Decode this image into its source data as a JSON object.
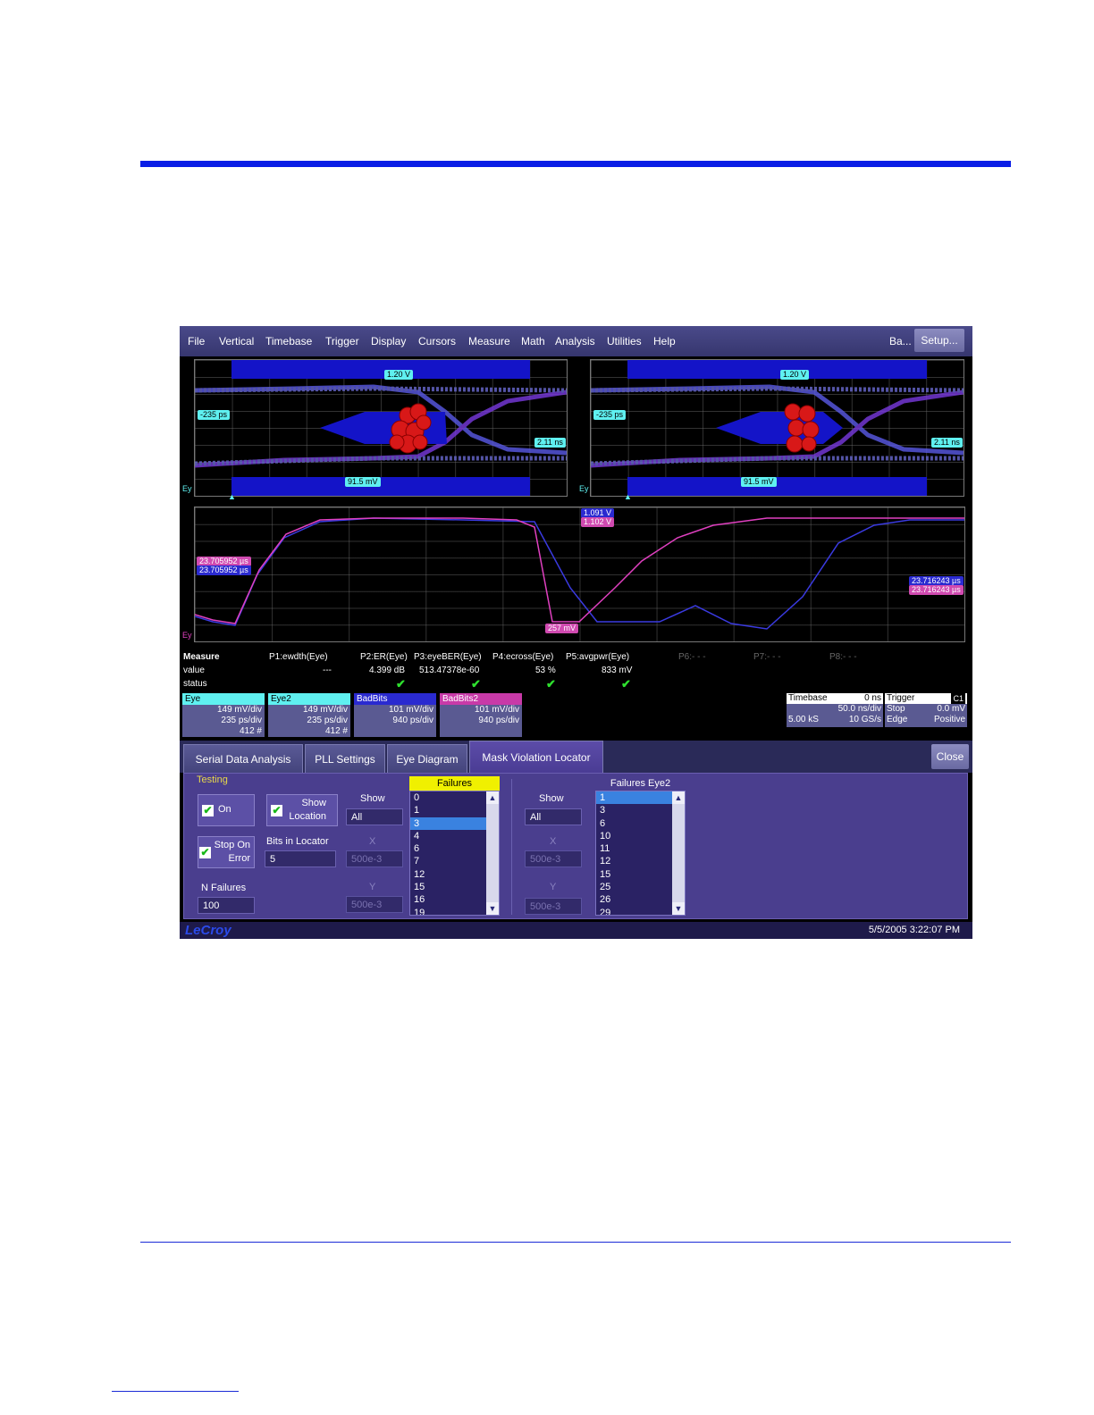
{
  "menubar": {
    "items": [
      "File",
      "Vertical",
      "Timebase",
      "Trigger",
      "Display",
      "Cursors",
      "Measure",
      "Math",
      "Analysis",
      "Utilities",
      "Help"
    ],
    "ba_label": "Ba...",
    "setup_label": "Setup..."
  },
  "eye1": {
    "top_label": "1.20 V",
    "left_label": "-235 ps",
    "right_label": "2.11 ns",
    "bottom_label": "91.5 mV",
    "trace_label": "Ey"
  },
  "eye2": {
    "top_label": "1.20 V",
    "left_label": "-235 ps",
    "right_label": "2.11 ns",
    "bottom_label": "91.5 mV",
    "trace_label": "Ey"
  },
  "wave": {
    "left_tag_mag": "23.705952 µs",
    "left_tag_blue": "23.705952 µs",
    "top_tag_blue": "1.091 V",
    "top_tag_mag": "1.102 V",
    "mid_tag": "257 mV",
    "right_tag_blue": "23.716243 µs",
    "right_tag_mag": "23.716243 µs",
    "trace_label": "Ey"
  },
  "measure": {
    "row_labels": [
      "Measure",
      "value",
      "status"
    ],
    "params": [
      {
        "name": "P1:ewdth(Eye)",
        "value": "---",
        "ok": false
      },
      {
        "name": "P2:ER(Eye)",
        "value": "4.399 dB",
        "ok": true
      },
      {
        "name": "P3:eyeBER(Eye)",
        "value": "513.47378e-60",
        "ok": true
      },
      {
        "name": "P4:ecross(Eye)",
        "value": "53 %",
        "ok": true
      },
      {
        "name": "P5:avgpwr(Eye)",
        "value": "833 mV",
        "ok": true
      }
    ],
    "empty_params": [
      "P6:- - -",
      "P7:- - -",
      "P8:- - -"
    ],
    "check_glyph": "✔"
  },
  "channels": [
    {
      "name": "Eye",
      "vdiv": "149 mV/div",
      "tdiv": "235 ps/div",
      "count": "412 #",
      "color": "#5ff0f0",
      "text": "#000000"
    },
    {
      "name": "Eye2",
      "vdiv": "149 mV/div",
      "tdiv": "235 ps/div",
      "count": "412 #",
      "color": "#5ff0f0",
      "text": "#000000"
    },
    {
      "name": "BadBits",
      "vdiv": "101 mV/div",
      "tdiv": "940 ps/div",
      "count": "",
      "color": "#2a2ad0",
      "text": "#ffffff"
    },
    {
      "name": "BadBits2",
      "vdiv": "101 mV/div",
      "tdiv": "940 ps/div",
      "count": "",
      "color": "#c83aa8",
      "text": "#ffffff"
    }
  ],
  "timebase": {
    "title": "Timebase",
    "offset": "0 ns",
    "tdiv": "50.0 ns/div",
    "samples": "5.00 kS",
    "rate": "10 GS/s"
  },
  "trigger": {
    "title": "Trigger",
    "channel": "C1",
    "mode": "Stop",
    "level": "0.0 mV",
    "type": "Edge",
    "slope": "Positive"
  },
  "tabs": [
    "Serial Data Analysis",
    "PLL Settings",
    "Eye Diagram",
    "Mask Violation Locator"
  ],
  "close_label": "Close",
  "dialog": {
    "testing_label": "Testing",
    "on_label": "On",
    "show_location_label_1": "Show",
    "show_location_label_2": "Location",
    "stop_on_error_label_1": "Stop On",
    "stop_on_error_label_2": "Error",
    "n_failures_label": "N Failures",
    "n_failures_value": "100",
    "bits_in_locator_label": "Bits in Locator",
    "bits_in_locator_value": "5",
    "show_label": "Show",
    "show_value": "All",
    "x_label": "X",
    "x_value": "500e-3",
    "y_label": "Y",
    "y_value": "500e-3",
    "failures_label": "Failures",
    "failures": [
      "0",
      "1",
      "3",
      "4",
      "6",
      "7",
      "12",
      "15",
      "16",
      "19"
    ],
    "failures_selected": 2,
    "show2_label": "Show",
    "show2_value": "All",
    "x2_label": "X",
    "x2_value": "500e-3",
    "y2_label": "Y",
    "y2_value": "500e-3",
    "failures2_label": "Failures Eye2",
    "failures2": [
      "1",
      "3",
      "6",
      "10",
      "11",
      "12",
      "15",
      "25",
      "26",
      "29"
    ],
    "failures2_selected": 0
  },
  "status": {
    "logo": "LeCroy",
    "datetime": "5/5/2005 3:22:07 PM"
  },
  "colors": {
    "menubar": "#3e3e7a",
    "mask": "#1414c8",
    "failure_marker": "#e01818",
    "trace_blue": "#3a3ae0",
    "trace_magenta": "#e040c0",
    "panel": "#4a3e8e"
  }
}
